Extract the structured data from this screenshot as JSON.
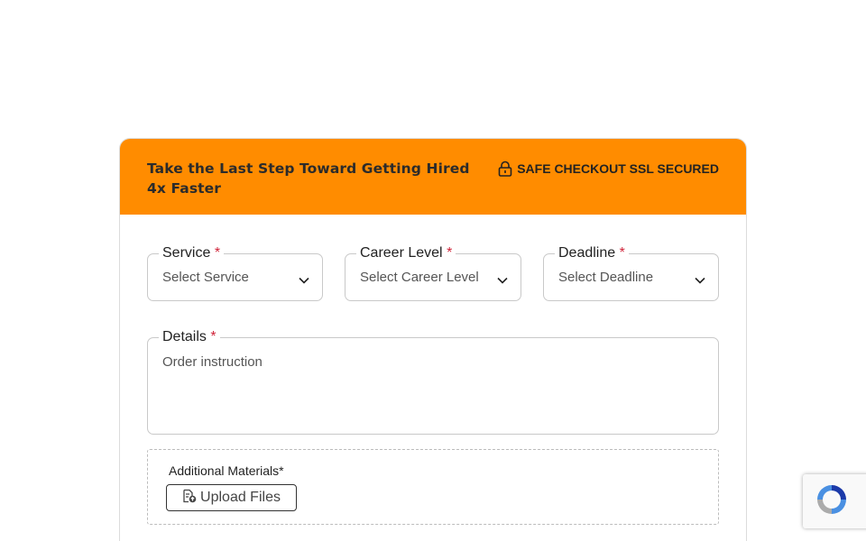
{
  "header": {
    "title": "Take the Last Step Toward Getting Hired 4x Faster",
    "secure_text": "SAFE CHECKOUT SSL SECURED",
    "secure_icon": "lock-icon",
    "accent_color": "#ff8c00"
  },
  "form": {
    "service": {
      "label": "Service",
      "required_mark": "*",
      "placeholder": "Select Service"
    },
    "career_level": {
      "label": "Career Level",
      "required_mark": "*",
      "placeholder": "Select Career Level"
    },
    "deadline": {
      "label": "Deadline",
      "required_mark": "*",
      "placeholder": "Select Deadline"
    },
    "details": {
      "label": "Details",
      "required_mark": "*",
      "placeholder": "Order instruction"
    },
    "materials": {
      "label": "Additional Materials*",
      "button_label": "Upload Files",
      "button_icon": "file-upload-icon"
    }
  },
  "recaptcha": {
    "icon": "recaptcha-icon"
  }
}
